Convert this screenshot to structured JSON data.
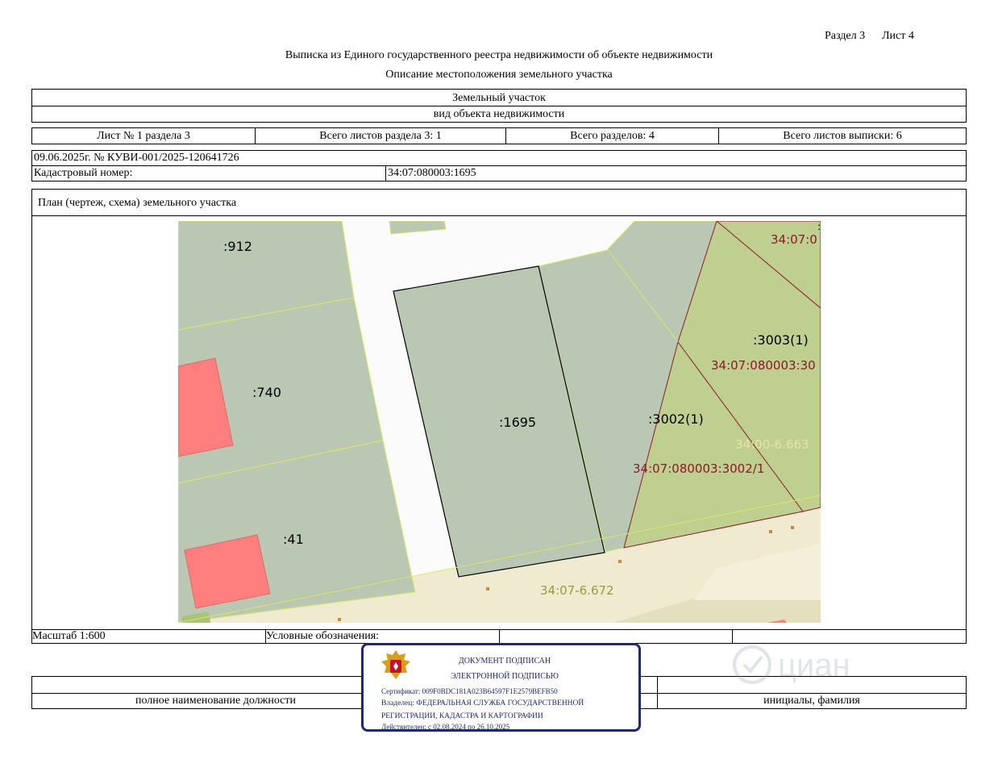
{
  "header": {
    "section": "Раздел 3",
    "sheet": "Лист 4",
    "title": "Выписка из Единого государственного реестра недвижимости об объекте недвижимости",
    "subtitle": "Описание местоположения земельного участка"
  },
  "object": {
    "type": "Земельный участок",
    "type_caption": "вид объекта недвижимости"
  },
  "sheets": {
    "sheet_no": "Лист № 1 раздела 3",
    "total_section_sheets": "Всего листов раздела 3: 1",
    "total_sections": "Всего разделов: 4",
    "total_sheets": "Всего листов выписки: 6"
  },
  "doc": {
    "date_no": "09.06.2025г. № КУВИ-001/2025-120641726",
    "cadastral_label": "Кадастровый номер:",
    "cadastral_value": "34:07:080003:1695"
  },
  "plan": {
    "title": "План (чертеж, схема) земельного участка",
    "scale": "Масштаб 1:600",
    "legend_label": "Условные обозначения:"
  },
  "map_labels": {
    "p912": ":912",
    "p740": ":740",
    "p41": ":41",
    "p1695": ":1695",
    "p3002": ":3002(1)",
    "p3003": ":3003(1)",
    "red_top": "34:07:0",
    "red_mid": "34:07:080003:30",
    "red_low": "34:07:080003:3002/1",
    "zone1": "34:00-6.663",
    "zone2": "34:07-6.672",
    "stray": ":"
  },
  "signature": {
    "position_caption": "полное наименование должности",
    "name_caption": "инициалы, фамилия"
  },
  "stamp": {
    "line1": "ДОКУМЕНТ ПОДПИСАН",
    "line2": "ЭЛЕКТРОННОЙ ПОДПИСЬЮ",
    "cert": "Сертификат: 009F0BDC181A023B64597F1E2579BEFB50",
    "owner1": "Владелец: ФЕДЕРАЛЬНАЯ СЛУЖБА ГОСУДАРСТВЕННОЙ",
    "owner2": "РЕГИСТРАЦИИ, КАДАСТРА И КАРТОГРАФИИ",
    "valid": "Действителен: с 02.08.2024 по 26.10.2025"
  },
  "colors": {
    "parcel_gray": "#bac8b3",
    "parcel_green": "#bfcf8f",
    "building_red": "#ff7f7f",
    "zone_beige": "#efead0",
    "cadastral_red": "#8b1a2b",
    "zone_olive": "#9a9a40",
    "stamp_blue": "#1f2a6e"
  }
}
